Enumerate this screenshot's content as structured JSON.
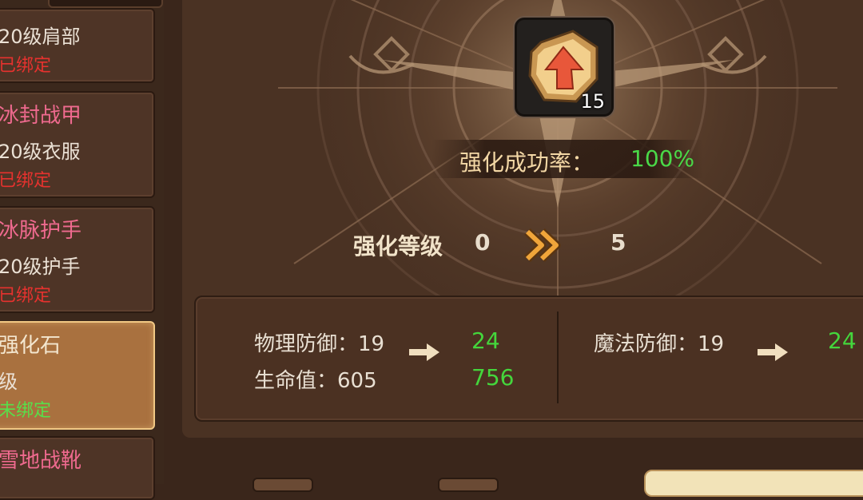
{
  "sidebar": {
    "items": [
      {
        "name": "",
        "type": "20级肩部",
        "bind": "已绑定",
        "name_color": "pink",
        "bind_color": "red",
        "selected": false
      },
      {
        "name": "冰封战甲",
        "type": "20级衣服",
        "bind": "已绑定",
        "name_color": "pink",
        "bind_color": "red",
        "selected": false
      },
      {
        "name": "冰脉护手",
        "type": "20级护手",
        "bind": "已绑定",
        "name_color": "pink",
        "bind_color": "red",
        "selected": false
      },
      {
        "name": "强化石",
        "type": "级",
        "bind": "未绑定",
        "name_color": "cream",
        "bind_color": "green",
        "selected": true
      },
      {
        "name": "雪地战靴",
        "type": "",
        "bind": "",
        "name_color": "pink",
        "bind_color": "red",
        "selected": false
      }
    ]
  },
  "material": {
    "icon": "upgrade-stone-icon",
    "count": "15"
  },
  "success_rate": {
    "label": "强化成功率：",
    "value": "100%"
  },
  "enhance_level": {
    "label": "强化等级",
    "from": "0",
    "to": "5"
  },
  "stats": {
    "physical_defense": {
      "label": "物理防御：19",
      "new_value": "24"
    },
    "hp": {
      "label": "生命值：605",
      "new_value": "756"
    },
    "magic_defense": {
      "label": "魔法防御：19",
      "new_value": "24"
    }
  },
  "colors": {
    "pink": "#ef6a8f",
    "red": "#e6322e",
    "green": "#57e04a",
    "accent_green": "#44d63c",
    "gold": "#f0a53a"
  }
}
